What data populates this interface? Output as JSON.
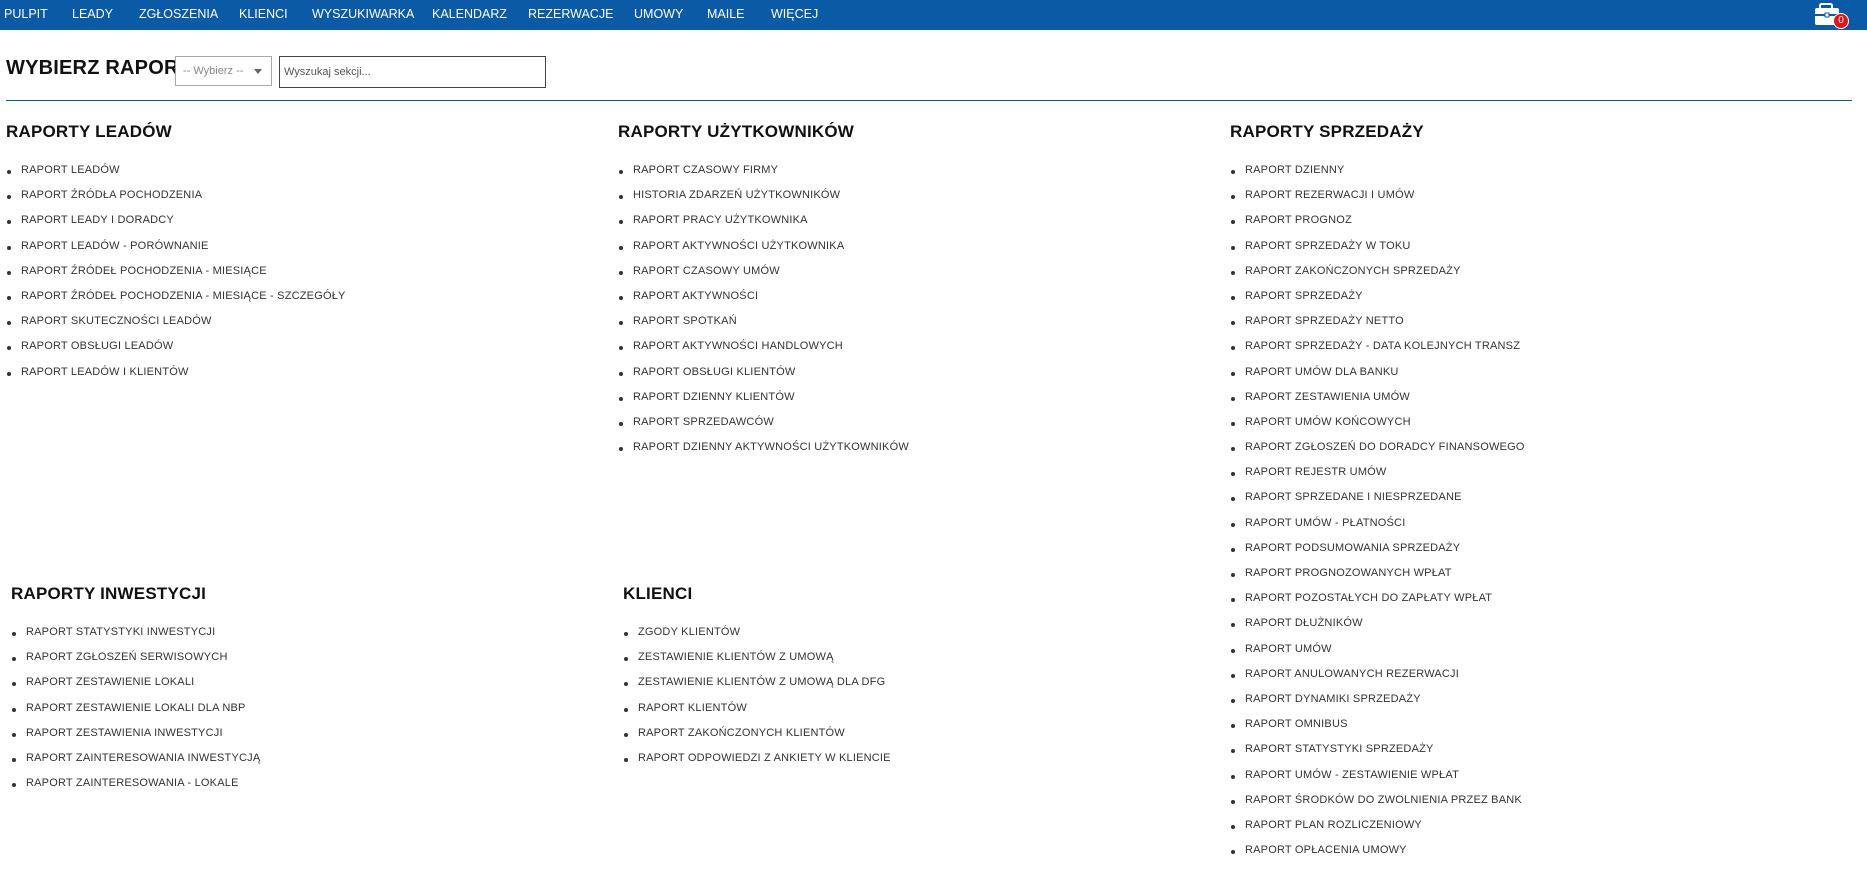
{
  "nav": {
    "items": [
      "PULPIT",
      "LEADY",
      "ZGŁOSZENIA",
      "KLIENCI",
      "WYSZUKIWARKA",
      "KALENDARZ",
      "REZERWACJE",
      "UMOWY",
      "MAILE",
      "WIĘCEJ"
    ],
    "cart_icon": "briefcase-icon",
    "cart_count": "0",
    "colors": {
      "bar": "#0b5aa6",
      "badge": "#e01515"
    }
  },
  "header": {
    "title": "WYBIERZ RAPORT",
    "select_value": "-- Wybierz --",
    "search_placeholder": "Wyszukaj sekcji..."
  },
  "sections": [
    {
      "title": "RAPORTY LEADÓW",
      "items": [
        "RAPORT LEADÓW",
        "RAPORT ŹRÓDŁA POCHODZENIA",
        "RAPORT LEADY I DORADCY",
        "RAPORT LEADÓW - PORÓWNANIE",
        "RAPORT ŹRÓDEŁ POCHODZENIA - MIESIĄCE",
        "RAPORT ŹRÓDEŁ POCHODZENIA - MIESIĄCE - SZCZEGÓŁY",
        "RAPORT SKUTECZNOŚCI LEADÓW",
        "RAPORT OBSŁUGI LEADÓW",
        "RAPORT LEADÓW I KLIENTÓW"
      ]
    },
    {
      "title": "RAPORTY UŻYTKOWNIKÓW",
      "items": [
        "RAPORT CZASOWY FIRMY",
        "HISTORIA ZDARZEŃ UŻYTKOWNIKÓW",
        "RAPORT PRACY UŻYTKOWNIKA",
        "RAPORT AKTYWNOŚCI UŻYTKOWNIKA",
        "RAPORT CZASOWY UMÓW",
        "RAPORT AKTYWNOŚCI",
        "RAPORT SPOTKAŃ",
        "RAPORT AKTYWNOŚCI HANDLOWYCH",
        "RAPORT OBSŁUGI KLIENTÓW",
        "RAPORT DZIENNY KLIENTÓW",
        "RAPORT SPRZEDAWCÓW",
        "RAPORT DZIENNY AKTYWNOŚCI UŻYTKOWNIKÓW"
      ]
    },
    {
      "title": "RAPORTY SPRZEDAŻY",
      "items": [
        "RAPORT DZIENNY",
        "RAPORT REZERWACJI I UMÓW",
        "RAPORT PROGNOZ",
        "RAPORT SPRZEDAŻY W TOKU",
        "RAPORT ZAKOŃCZONYCH SPRZEDAŻY",
        "RAPORT SPRZEDAŻY",
        "RAPORT SPRZEDAŻY NETTO",
        "RAPORT SPRZEDAŻY - DATA KOLEJNYCH TRANSZ",
        "RAPORT UMÓW DLA BANKU",
        "RAPORT ZESTAWIENIA UMÓW",
        "RAPORT UMÓW KOŃCOWYCH",
        "RAPORT ZGŁOSZEŃ DO DORADCY FINANSOWEGO",
        "RAPORT REJESTR UMÓW",
        "RAPORT SPRZEDANE I NIESPRZEDANE",
        "RAPORT UMÓW - PŁATNOŚCI",
        "RAPORT PODSUMOWANIA SPRZEDAŻY",
        "RAPORT PROGNOZOWANYCH WPŁAT",
        "RAPORT POZOSTAŁYCH DO ZAPŁATY WPŁAT",
        "RAPORT DŁUŻNIKÓW",
        "RAPORT UMÓW",
        "RAPORT ANULOWANYCH REZERWACJI",
        "RAPORT DYNAMIKI SPRZEDAŻY",
        "RAPORT OMNIBUS",
        "RAPORT STATYSTYKI SPRZEDAŻY",
        "RAPORT UMÓW - ZESTAWIENIE WPŁAT",
        "RAPORT ŚRODKÓW DO ZWOLNIENIA PRZEZ BANK",
        "RAPORT PLAN ROZLICZENIOWY",
        "RAPORT OPŁACENIA UMOWY"
      ]
    },
    {
      "title": "RAPORTY INWESTYCJI",
      "items": [
        "RAPORT STATYSTYKI INWESTYCJI",
        "RAPORT ZGŁOSZEŃ SERWISOWYCH",
        "RAPORT ZESTAWIENIE LOKALI",
        "RAPORT ZESTAWIENIE LOKALI DLA NBP",
        "RAPORT ZESTAWIENIA INWESTYCJI",
        "RAPORT ZAINTERESOWANIA INWESTYCJĄ",
        "RAPORT ZAINTERESOWANIA - LOKALE"
      ]
    },
    {
      "title": "KLIENCI",
      "items": [
        "ZGODY KLIENTÓW",
        "ZESTAWIENIE KLIENTÓW Z UMOWĄ",
        "ZESTAWIENIE KLIENTÓW Z UMOWĄ DLA DFG",
        "RAPORT KLIENTÓW",
        "RAPORT ZAKOŃCZONYCH KLIENTÓW",
        "RAPORT ODPOWIEDZI Z ANKIETY W KLIENCIE"
      ]
    }
  ]
}
